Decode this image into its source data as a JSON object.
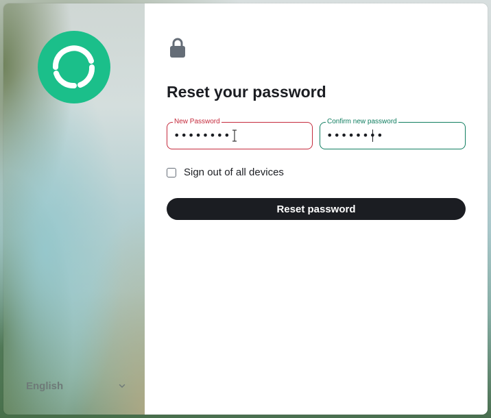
{
  "language_selector": {
    "value": "English",
    "icon": "chevron-down-icon"
  },
  "logo": {
    "icon": "element-logo-icon",
    "color": "#1bbf8a"
  },
  "header": {
    "icon": "lock-icon",
    "title": "Reset your password"
  },
  "form": {
    "new_password": {
      "label": "New Password",
      "value": "••••••••",
      "state_color": "#c4293b"
    },
    "confirm_password": {
      "label": "Confirm new password",
      "value": "••••••••",
      "state_color": "#0f7d5f"
    },
    "sign_out_all": {
      "label": "Sign out of all devices",
      "checked": false
    },
    "submit_label": "Reset password"
  },
  "colors": {
    "button_bg": "#1b1d22",
    "text": "#1b1d22"
  }
}
